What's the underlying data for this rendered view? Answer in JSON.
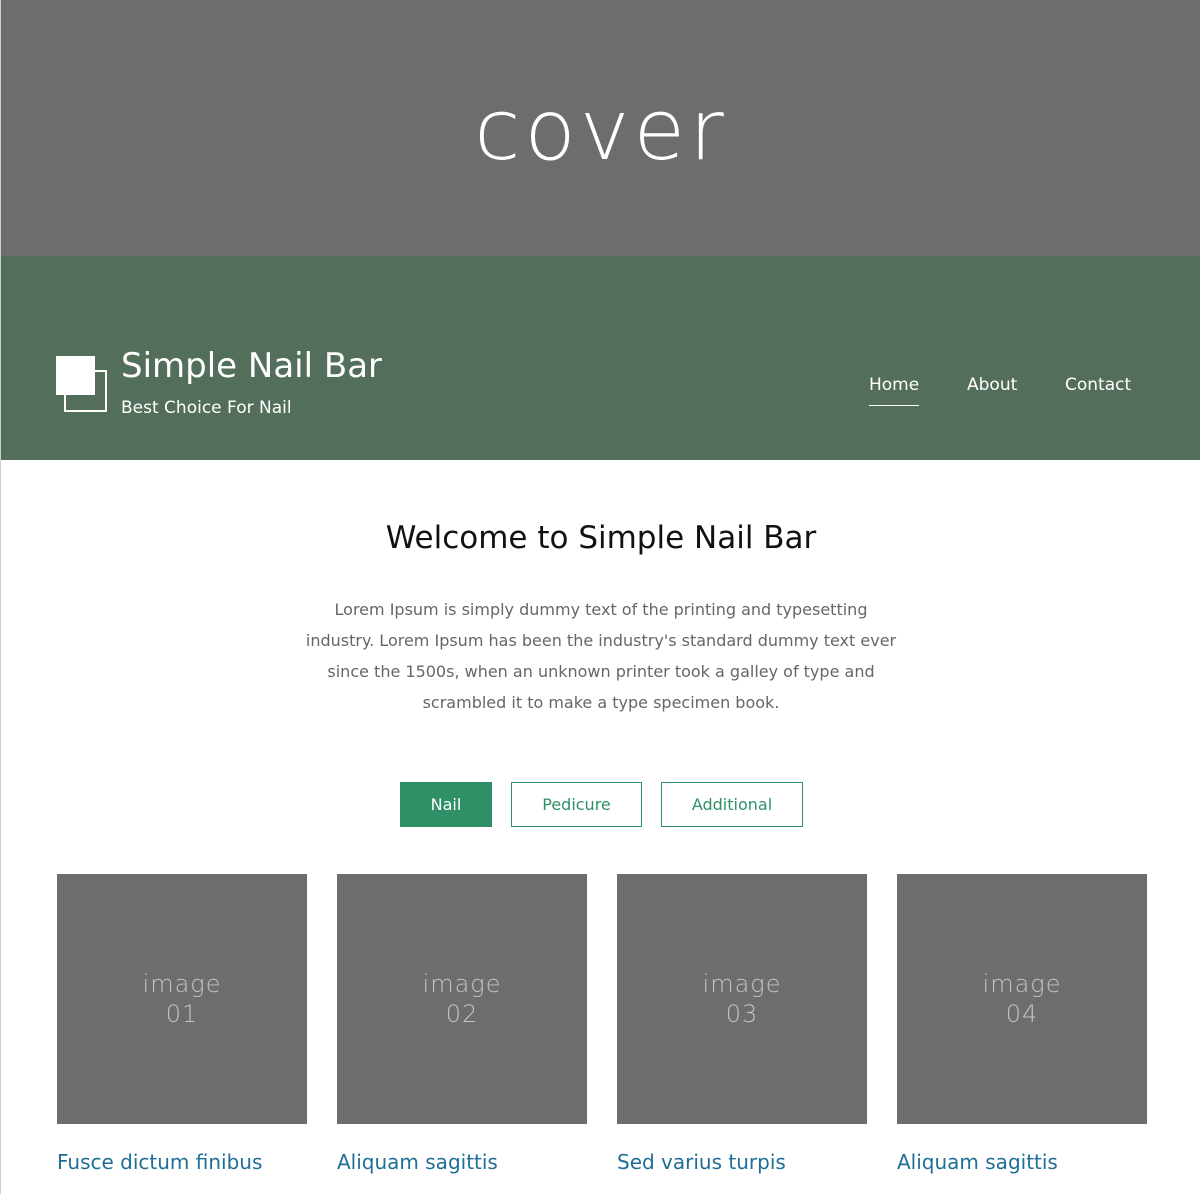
{
  "cover": {
    "text": "cover"
  },
  "header": {
    "title": "Simple Nail Bar",
    "tagline": "Best Choice For Nail",
    "logo_icon": "stacked-squares-icon",
    "background_color": "#546e5c",
    "nav": [
      {
        "label": "Home",
        "active": true
      },
      {
        "label": "About",
        "active": false
      },
      {
        "label": "Contact",
        "active": false
      }
    ]
  },
  "welcome": {
    "title": "Welcome to Simple Nail Bar",
    "text": "Lorem Ipsum is simply dummy text of the printing and typesetting industry. Lorem Ipsum has been the industry's standard dummy text ever since the 1500s, when an unknown printer took a galley of type and scrambled it to make a type specimen book."
  },
  "tabs": [
    {
      "label": "Nail",
      "active": true
    },
    {
      "label": "Pedicure",
      "active": false
    },
    {
      "label": "Additional",
      "active": false
    }
  ],
  "accent_color": "#2f9068",
  "gallery": [
    {
      "image_word": "image",
      "image_number": "01",
      "title": "Fusce dictum finibus"
    },
    {
      "image_word": "image",
      "image_number": "02",
      "title": "Aliquam sagittis"
    },
    {
      "image_word": "image",
      "image_number": "03",
      "title": "Sed varius turpis"
    },
    {
      "image_word": "image",
      "image_number": "04",
      "title": "Aliquam sagittis"
    }
  ]
}
